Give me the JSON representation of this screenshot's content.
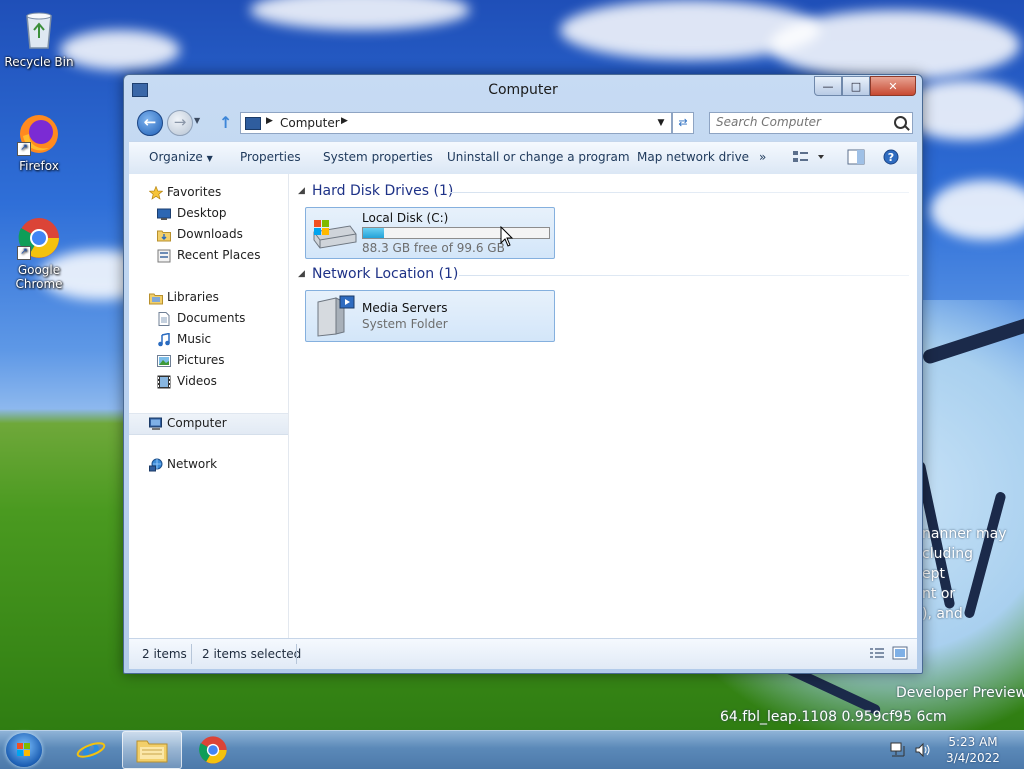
{
  "desktop": {
    "icons": [
      {
        "label": "Recycle Bin"
      },
      {
        "label": "Firefox"
      },
      {
        "label": "Google Chrome"
      }
    ],
    "watermark": {
      "lines": [
        "nanner may",
        "cluding",
        "ept",
        "nt or",
        "), and"
      ],
      "build_line1": "Developer Preview",
      "build_line2": "64.fbl_leap.1108 0.959cf95 6cm"
    }
  },
  "window": {
    "title": "Computer",
    "address": {
      "path": [
        "Computer"
      ]
    },
    "search": {
      "placeholder": "Search Computer"
    },
    "toolbar": {
      "organize": "Organize",
      "properties": "Properties",
      "system_properties": "System properties",
      "uninstall": "Uninstall or change a program",
      "map_drive": "Map network drive",
      "more": "»"
    },
    "nav_pane": {
      "favorites": "Favorites",
      "desktop": "Desktop",
      "downloads": "Downloads",
      "recent": "Recent Places",
      "libraries": "Libraries",
      "documents": "Documents",
      "music": "Music",
      "pictures": "Pictures",
      "videos": "Videos",
      "computer": "Computer",
      "network": "Network"
    },
    "groups": {
      "hdd": {
        "header": "Hard Disk Drives (1)",
        "drive": {
          "name": "Local Disk (C:)",
          "free": "88.3 GB free of 99.6 GB",
          "used_fraction": 0.113
        }
      },
      "network": {
        "header": "Network Location (1)",
        "item": {
          "name": "Media Servers",
          "type": "System Folder"
        }
      }
    },
    "status": {
      "items": "2 items",
      "selected": "2 items selected"
    }
  },
  "taskbar": {
    "time": "5:23 AM",
    "date": "3/4/2022"
  },
  "colors": {
    "group_header": "#1e3287",
    "selection": "#d3e6f9",
    "capacity_fill": "#23a2d8"
  }
}
